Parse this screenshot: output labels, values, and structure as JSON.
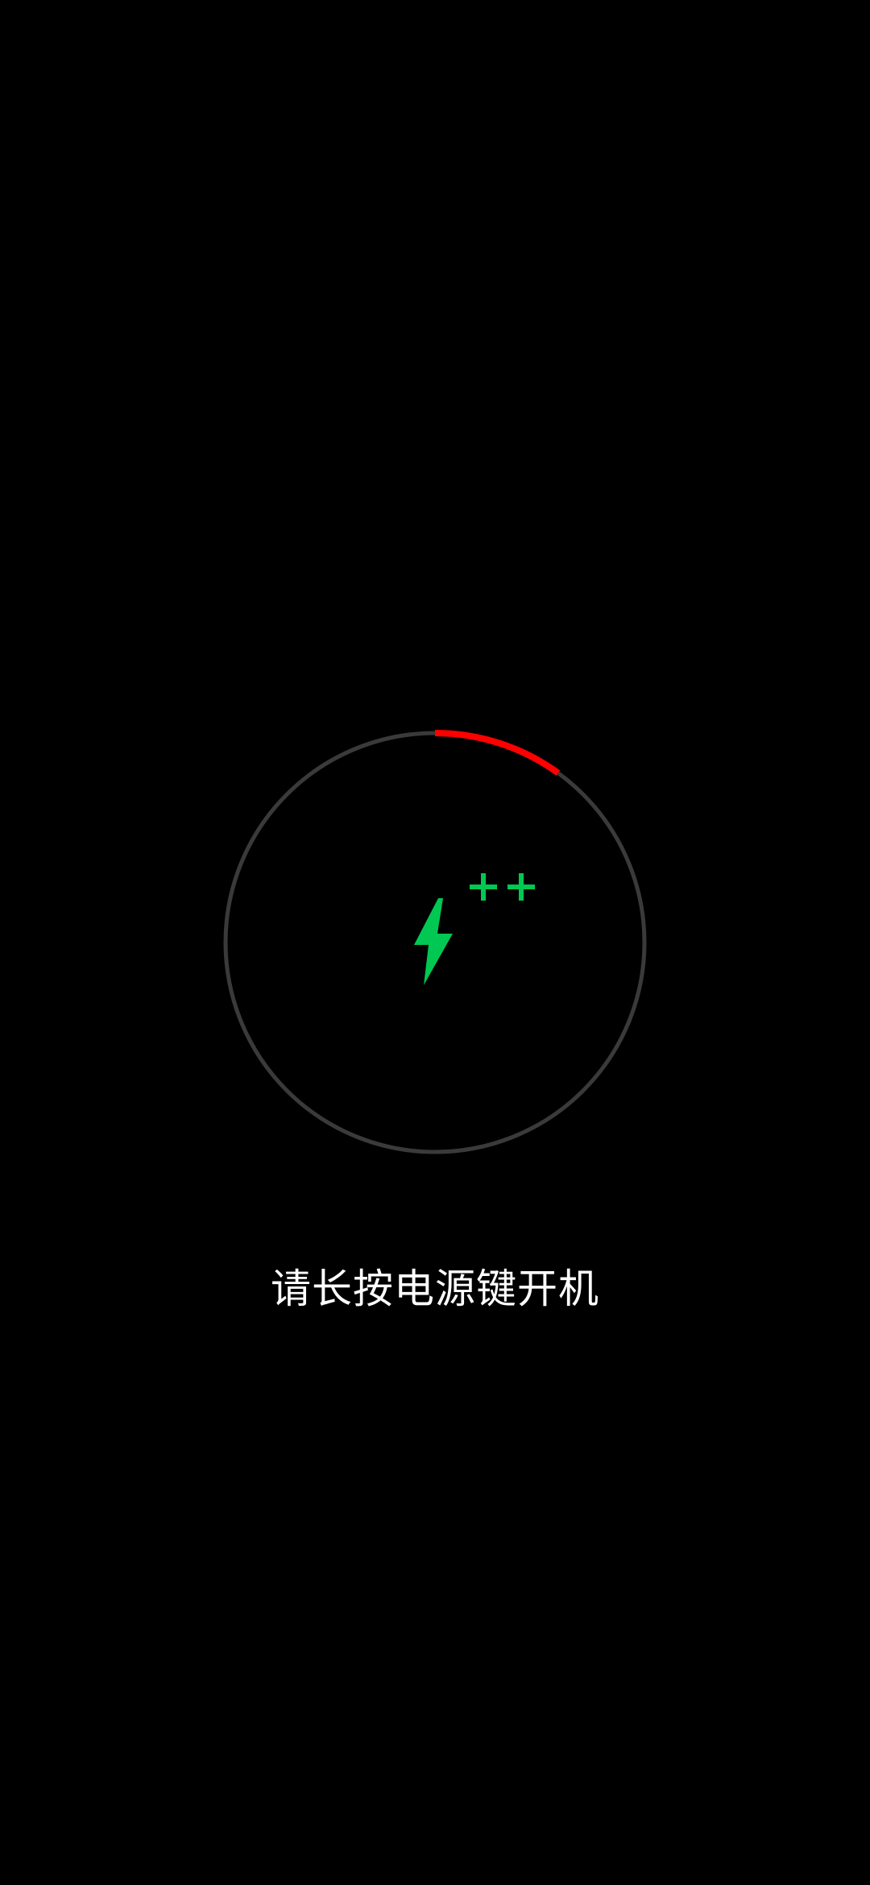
{
  "screen": {
    "hint": "请长按电源键开机"
  },
  "battery": {
    "level_percent": 10,
    "charging": true,
    "indicator_icon": "lightning-bolt-icon",
    "extra_icons": [
      "plus-icon",
      "plus-icon"
    ]
  },
  "colors": {
    "background": "#000000",
    "ring_track": "#3a3a3a",
    "ring_progress": "#ff0000",
    "charge_accent": "#00c853",
    "text": "#ffffff"
  }
}
